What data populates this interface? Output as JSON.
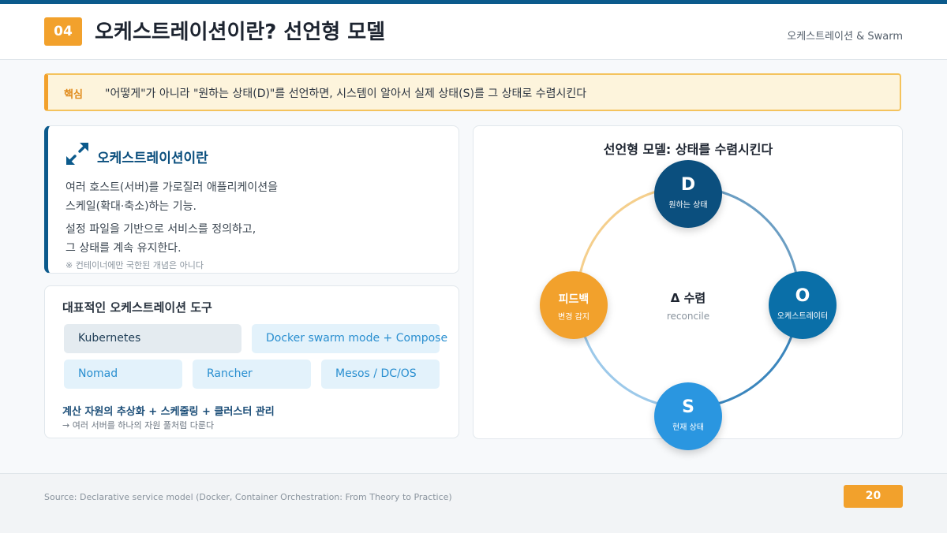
{
  "header": {
    "section_number": "04",
    "title": "오케스트레이션이란? 선언형 모델",
    "tag": "오케스트레이션 & Swarm"
  },
  "key_point": {
    "label": "핵심",
    "text": "\"어떻게\"가 아니라 \"원하는 상태(D)\"를 선언하면, 시스템이 알아서 실제 상태(S)를 그 상태로 수렴시킨다"
  },
  "definition": {
    "icon": "expand-arrows-icon",
    "title": "오케스트레이션이란",
    "p1_line1": "여러 호스트(서버)를 가로질러 애플리케이션을",
    "p1_line2": "스케일(확대·축소)하는 기능.",
    "p2_line1": "설정 파일을 기반으로 서비스를 정의하고,",
    "p2_line2": "그 상태를 계속 유지한다.",
    "note": "※ 컨테이너에만 국한된 개념은 아니다"
  },
  "tools": {
    "title": "대표적인 오케스트레이션 도구",
    "items": [
      "Kubernetes",
      "Docker swarm mode + Compose",
      "Nomad",
      "Rancher",
      "Mesos / DC/OS"
    ],
    "summary": "계산 자원의 추상화 + 스케줄링 + 클러스터 관리",
    "summary_sub": "→ 여러 서버를 하나의 자원 풀처럼 다룬다"
  },
  "diagram": {
    "title": "선언형 모델: 상태를 수렴시킨다",
    "center_title": "Δ 수렴",
    "center_sub": "reconcile",
    "nodes": [
      {
        "id": "D",
        "letter": "D",
        "label": "원하는 상태",
        "color": "#0b4f7e"
      },
      {
        "id": "O",
        "letter": "O",
        "label": "오케스트레이터",
        "color": "#0a6fa8"
      },
      {
        "id": "S",
        "letter": "S",
        "label": "현재 상태",
        "color": "#2a96e0"
      },
      {
        "id": "F",
        "title": "피드백",
        "label": "변경 감지",
        "color": "#f2a12c"
      }
    ]
  },
  "footer": {
    "source": "Source: Declarative service model (Docker, Container Orchestration: From Theory to Practice)",
    "page": "20"
  },
  "colors": {
    "primary": "#0b5a8c",
    "accent": "#f2a12c",
    "highlight_bg": "#fdf4dc"
  }
}
